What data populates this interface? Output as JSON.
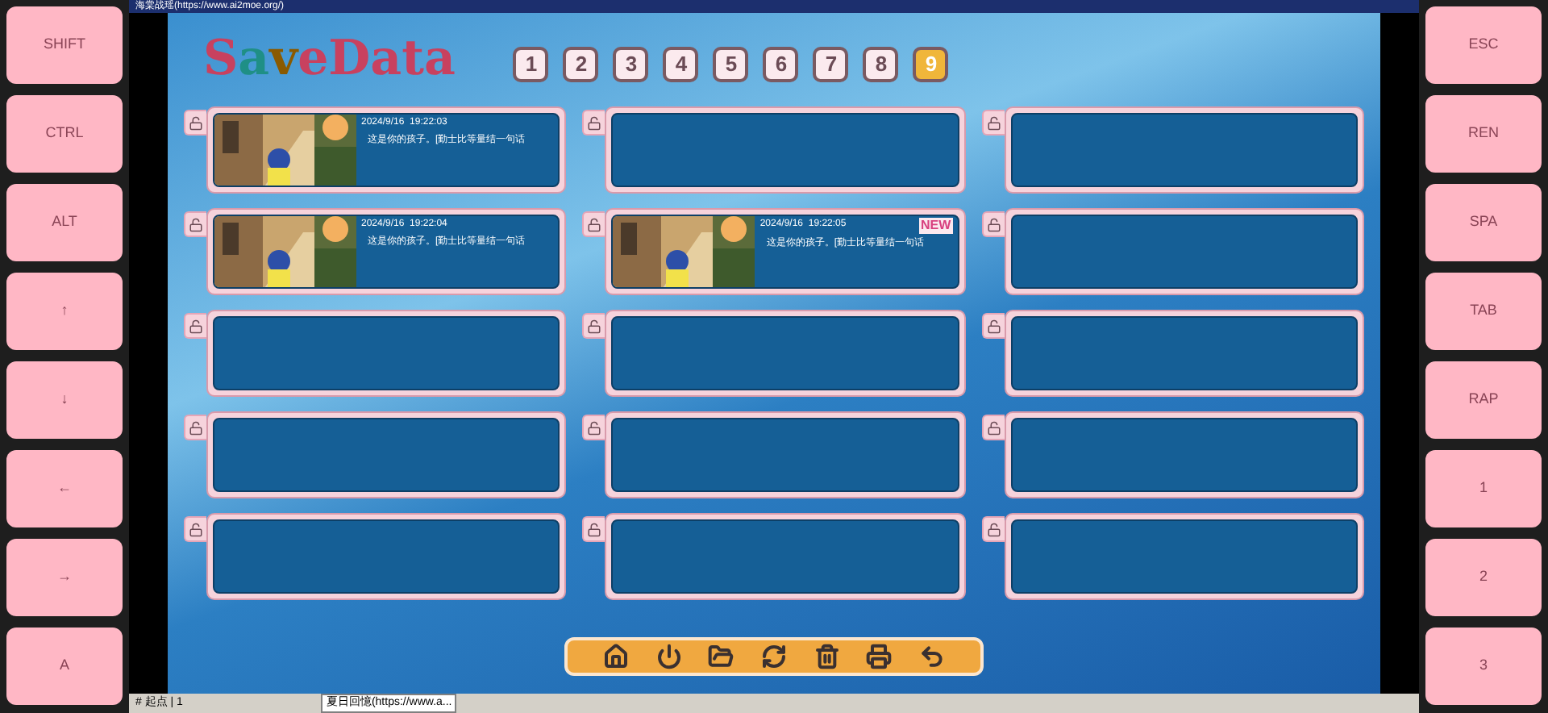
{
  "window": {
    "title": "海棠战瑶(https://www.ai2moe.org/)"
  },
  "left_keys": [
    "SHIFT",
    "CTRL",
    "ALT",
    "↑",
    "↓",
    "←",
    "→",
    "A"
  ],
  "right_keys": [
    "ESC",
    "REN",
    "SPA",
    "TAB",
    "RAP",
    "1",
    "2",
    "3"
  ],
  "logo": "SaveData",
  "pages": [
    {
      "label": "1",
      "selected": false
    },
    {
      "label": "2",
      "selected": false
    },
    {
      "label": "3",
      "selected": false
    },
    {
      "label": "4",
      "selected": false
    },
    {
      "label": "5",
      "selected": false
    },
    {
      "label": "6",
      "selected": false
    },
    {
      "label": "7",
      "selected": false
    },
    {
      "label": "8",
      "selected": false
    },
    {
      "label": "9",
      "selected": true
    }
  ],
  "slots": [
    {
      "kind": "filled",
      "date": "2024/9/16  19:22:03",
      "text": "这是你的孩子。[勤士比等量结一句话"
    },
    {
      "kind": "empty"
    },
    {
      "kind": "empty"
    },
    {
      "kind": "filled",
      "date": "2024/9/16  19:22:04",
      "text": "这是你的孩子。[勤士比等量结一句话"
    },
    {
      "kind": "filled",
      "date": "2024/9/16  19:22:05",
      "text": "这是你的孩子。[勤士比等量结一句话",
      "new_label": "NEW"
    },
    {
      "kind": "empty"
    },
    {
      "kind": "empty"
    },
    {
      "kind": "empty"
    },
    {
      "kind": "empty"
    },
    {
      "kind": "empty"
    },
    {
      "kind": "empty"
    },
    {
      "kind": "empty"
    },
    {
      "kind": "empty"
    },
    {
      "kind": "empty"
    },
    {
      "kind": "empty"
    }
  ],
  "toolbar": [
    {
      "kind": "home"
    },
    {
      "kind": "power"
    },
    {
      "kind": "folder"
    },
    {
      "kind": "refresh"
    },
    {
      "kind": "trash"
    },
    {
      "kind": "print"
    },
    {
      "kind": "back"
    }
  ],
  "taskbar": {
    "start": "# 起点 | 1",
    "task": "夏日回憶(https://www.a..."
  }
}
